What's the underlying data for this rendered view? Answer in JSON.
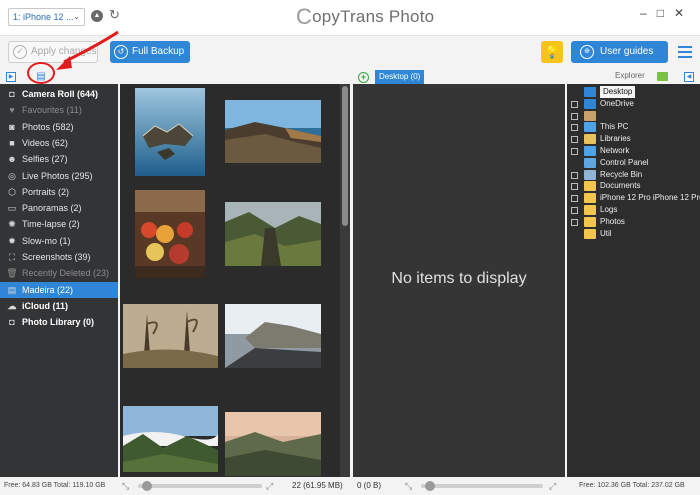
{
  "app": {
    "logo_rest": "opyTrans Photo",
    "logo_letter": "C"
  },
  "topbar": {
    "device": "1: iPhone 12 ...",
    "device_chevron": "⌄",
    "eject_glyph": "▲",
    "refresh_glyph": "↻"
  },
  "toolbar": {
    "apply_label": "Apply changes",
    "backup_label": "Full Backup",
    "guides_label": "User guides",
    "bulb_glyph": "💡"
  },
  "panels": {
    "desktop_tab": "Desktop (0)",
    "explorer_label": "Explorer",
    "empty_message": "No items to display"
  },
  "albums": [
    {
      "label": "Camera Roll (644)",
      "icon": "camera-icon",
      "glyph": "◘",
      "style": "bold"
    },
    {
      "label": "Favourites (11)",
      "icon": "heart-icon",
      "glyph": "♥",
      "style": "dim"
    },
    {
      "label": "Photos (582)",
      "icon": "photo-icon",
      "glyph": "◙",
      "style": "normal"
    },
    {
      "label": "Videos (62)",
      "icon": "video-icon",
      "glyph": "■",
      "style": "normal"
    },
    {
      "label": "Selfies (27)",
      "icon": "selfie-icon",
      "glyph": "☻",
      "style": "normal"
    },
    {
      "label": "Live Photos (295)",
      "icon": "live-photo-icon",
      "glyph": "◎",
      "style": "normal"
    },
    {
      "label": "Portraits (2)",
      "icon": "portrait-icon",
      "glyph": "⬡",
      "style": "normal"
    },
    {
      "label": "Panoramas (2)",
      "icon": "panorama-icon",
      "glyph": "▭",
      "style": "normal"
    },
    {
      "label": "Time-lapse (2)",
      "icon": "timelapse-icon",
      "glyph": "✺",
      "style": "normal"
    },
    {
      "label": "Slow-mo (1)",
      "icon": "slowmo-icon",
      "glyph": "✹",
      "style": "normal"
    },
    {
      "label": "Screenshots (39)",
      "icon": "screenshot-icon",
      "glyph": "⛶",
      "style": "normal"
    },
    {
      "label": "Recently Deleted (23)",
      "icon": "trash-icon",
      "glyph": "🗑",
      "style": "dim"
    },
    {
      "label": "Madeira (22)",
      "icon": "album-icon",
      "glyph": "▤",
      "style": "selected"
    },
    {
      "label": "iCloud (11)",
      "icon": "cloud-icon",
      "glyph": "☁",
      "style": "bold"
    },
    {
      "label": "Photo Library (0)",
      "icon": "camera-icon",
      "glyph": "◘",
      "style": "bold"
    }
  ],
  "tree": [
    {
      "label": "Desktop",
      "icon": "desktop-icon",
      "color": "#2f86d6",
      "box": false,
      "selected": true
    },
    {
      "label": "OneDrive",
      "icon": "cloud-icon",
      "color": "#2f86d6",
      "box": true,
      "selected": false
    },
    {
      "label": "",
      "icon": "user-icon",
      "color": "#c9a16b",
      "box": true,
      "selected": false
    },
    {
      "label": "This PC",
      "icon": "computer-icon",
      "color": "#4ea2e8",
      "box": true,
      "selected": false
    },
    {
      "label": "Libraries",
      "icon": "library-icon",
      "color": "#e8c35a",
      "box": true,
      "selected": false
    },
    {
      "label": "Network",
      "icon": "network-icon",
      "color": "#4ea2e8",
      "box": true,
      "selected": false
    },
    {
      "label": "Control Panel",
      "icon": "control-panel-icon",
      "color": "#5ea7df",
      "box": false,
      "selected": false
    },
    {
      "label": "Recycle Bin",
      "icon": "recycle-bin-icon",
      "color": "#8fb4d6",
      "box": true,
      "selected": false
    },
    {
      "label": "Documents",
      "icon": "folder-icon",
      "color": "#f3c54c",
      "box": true,
      "selected": false
    },
    {
      "label": "iPhone 12 Pro iPhone 12 Pro",
      "icon": "folder-icon",
      "color": "#f3c54c",
      "box": true,
      "selected": false
    },
    {
      "label": "Logs",
      "icon": "folder-icon",
      "color": "#f3c54c",
      "box": true,
      "selected": false
    },
    {
      "label": "Photos",
      "icon": "folder-icon",
      "color": "#f3c54c",
      "box": true,
      "selected": false
    },
    {
      "label": "Util",
      "icon": "folder-icon",
      "color": "#f3c54c",
      "box": false,
      "selected": false
    }
  ],
  "status": {
    "device_free": "Free: 64.83 GB Total: 119.10 GB",
    "gallery_count": "22 (61.95 MB)",
    "center_count": "0 (0 B)",
    "pc_free": "Free: 102.36 GB Total: 237.02 GB",
    "zoom_out_glyph": "⤡",
    "zoom_in_glyph": "⤢"
  },
  "colors": {
    "accent": "#2f86d6",
    "annotation": "#e21c1c",
    "add": "#3aa44a",
    "bulb": "#f8c31b"
  }
}
